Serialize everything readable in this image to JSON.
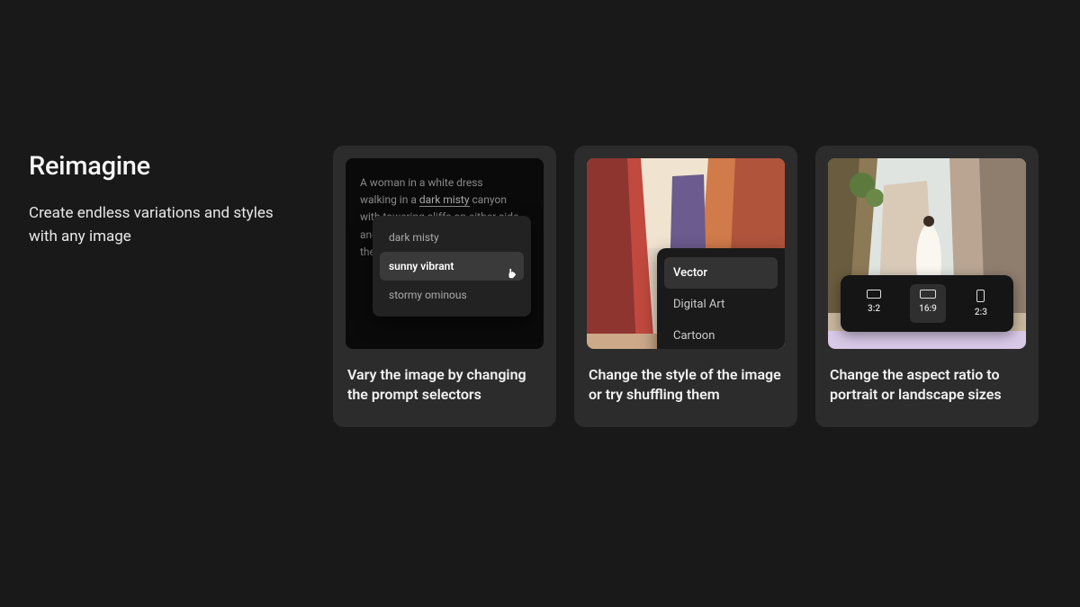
{
  "intro": {
    "heading": "Reimagine",
    "subheading": "Create endless variations and styles with any image"
  },
  "cards": [
    {
      "caption": "Vary the image by changing the prompt selectors",
      "prompt": {
        "line1": "A woman in a white dress",
        "line2a": "walking in a ",
        "line2_underlined": "dark misty",
        "line2b": " canyon",
        "line3": "with towering cliffs on either side",
        "line4": "and sunlight picture in",
        "line5": "the"
      },
      "dropdown": [
        "dark misty",
        "sunny vibrant",
        "stormy ominous"
      ],
      "selected_index": 1
    },
    {
      "caption": "Change the style of the image or try shuffling them",
      "style_menu": [
        "Vector",
        "Digital Art",
        "Cartoon"
      ],
      "selected_index": 0
    },
    {
      "caption": "Change the aspect ratio to portrait or landscape sizes",
      "ratios": [
        "3:2",
        "16:9",
        "2:3"
      ],
      "selected_index": 1
    }
  ]
}
